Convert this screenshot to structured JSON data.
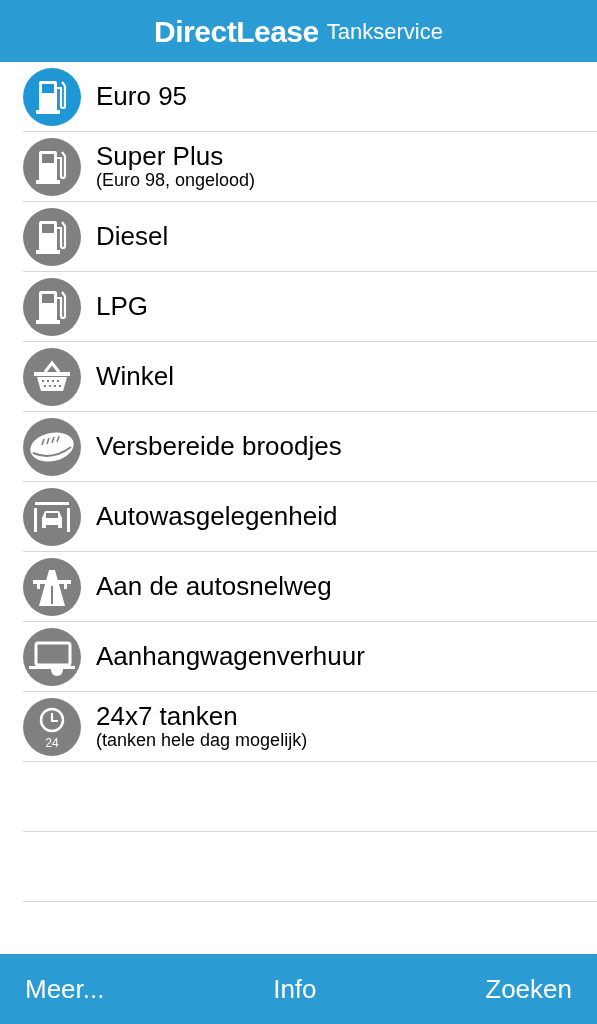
{
  "header": {
    "brand": "DirectLease",
    "title": "Tankservice"
  },
  "items": [
    {
      "kind": "fuel",
      "label": "Euro 95",
      "selected": true
    },
    {
      "kind": "fuel",
      "label": "Super Plus",
      "sub": "(Euro 98, ongelood)",
      "selected": false
    },
    {
      "kind": "fuel",
      "label": "Diesel",
      "selected": false
    },
    {
      "kind": "fuel",
      "label": "LPG",
      "selected": false
    },
    {
      "kind": "shop",
      "label": "Winkel",
      "selected": false
    },
    {
      "kind": "sandwich",
      "label": "Versbereide broodjes",
      "selected": false
    },
    {
      "kind": "carwash",
      "label": "Autowasgelegenheid",
      "selected": false
    },
    {
      "kind": "highway",
      "label": "Aan de autosnelweg",
      "selected": false
    },
    {
      "kind": "trailer",
      "label": "Aanhangwagenverhuur",
      "selected": false
    },
    {
      "kind": "clock",
      "label": "24x7 tanken",
      "sub": "(tanken hele dag mogelijk)",
      "icon_text": "24",
      "selected": false
    }
  ],
  "toolbar": [
    "Meer...",
    "Info",
    "Zoeken"
  ]
}
